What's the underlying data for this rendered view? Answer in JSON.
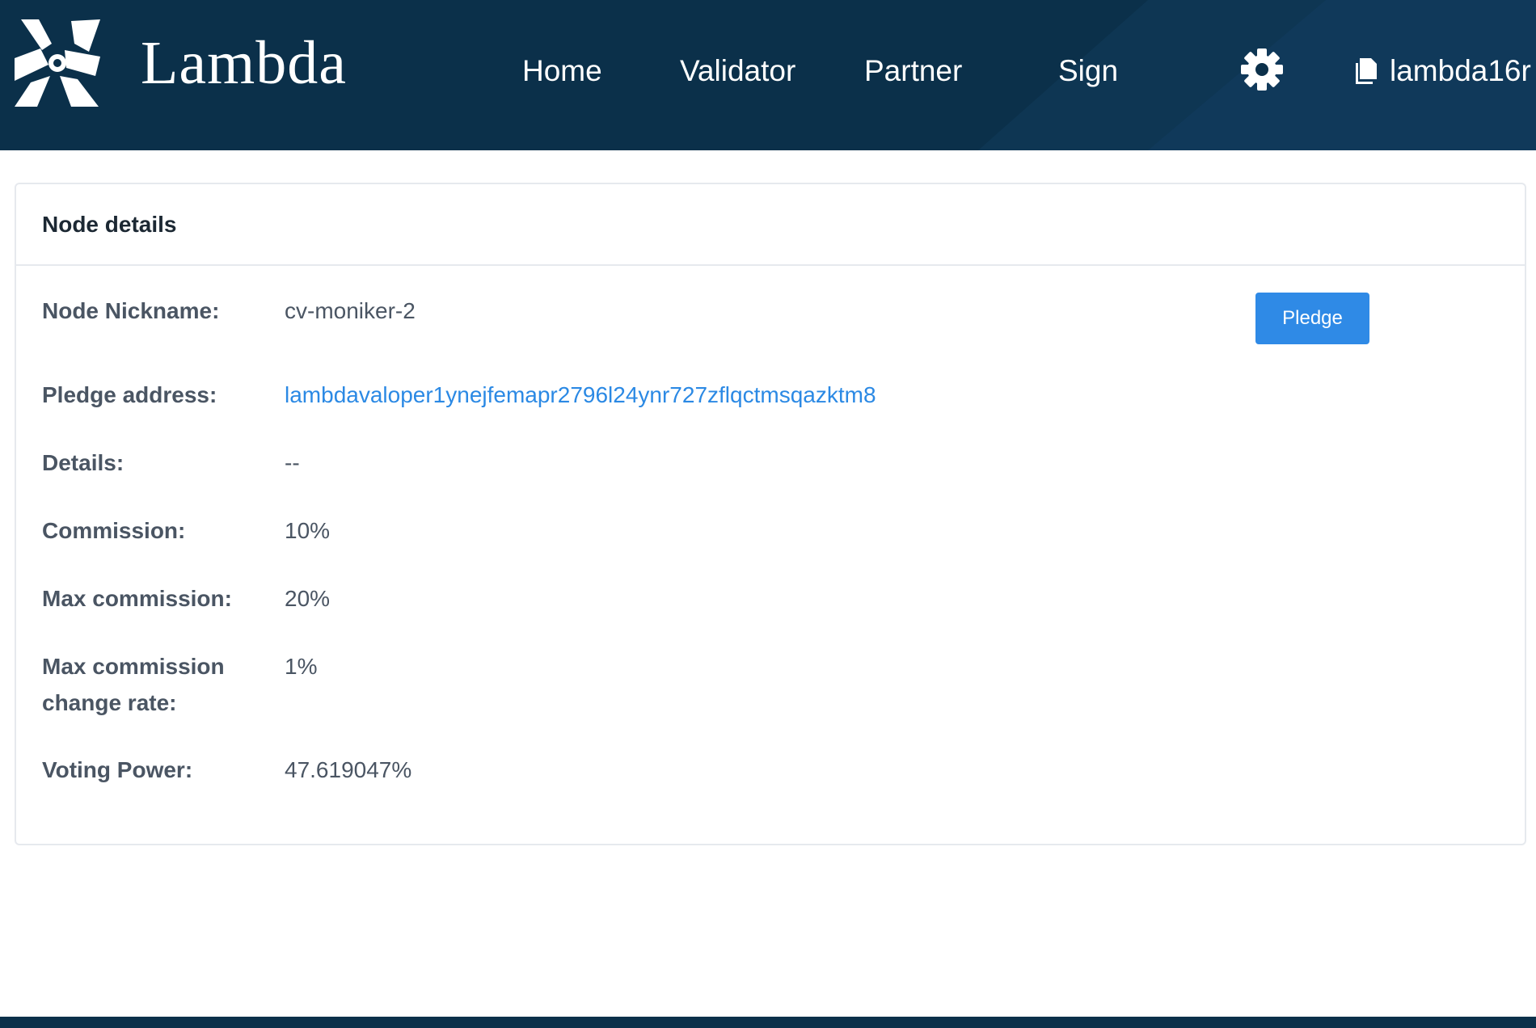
{
  "header": {
    "logo_text": "Lambda",
    "nav": {
      "home": "Home",
      "validator": "Validator",
      "partner": "Partner",
      "sign": "Sign"
    },
    "settings_icon": "gear-icon",
    "account_icon": "document-icon",
    "account_label": "lambda16r"
  },
  "card": {
    "title": "Node details",
    "pledge_button": "Pledge",
    "rows": [
      {
        "label": "Node Nickname:",
        "value": "cv-moniker-2"
      },
      {
        "label": "Pledge address:",
        "value": "lambdavaloper1ynejfemapr2796l24ynr727zflqctmsqazktm8"
      },
      {
        "label": "Details:",
        "value": "--"
      },
      {
        "label": "Commission:",
        "value": "10%"
      },
      {
        "label": "Max commission:",
        "value": "20%"
      },
      {
        "label": "Max commission change rate:",
        "value": "1%"
      },
      {
        "label": "Voting Power:",
        "value": "47.619047%"
      }
    ]
  },
  "colors": {
    "header_bg": "#0b304a",
    "link": "#2b89e4",
    "button_bg": "#2f8ae6",
    "label_text": "#4a5563"
  }
}
